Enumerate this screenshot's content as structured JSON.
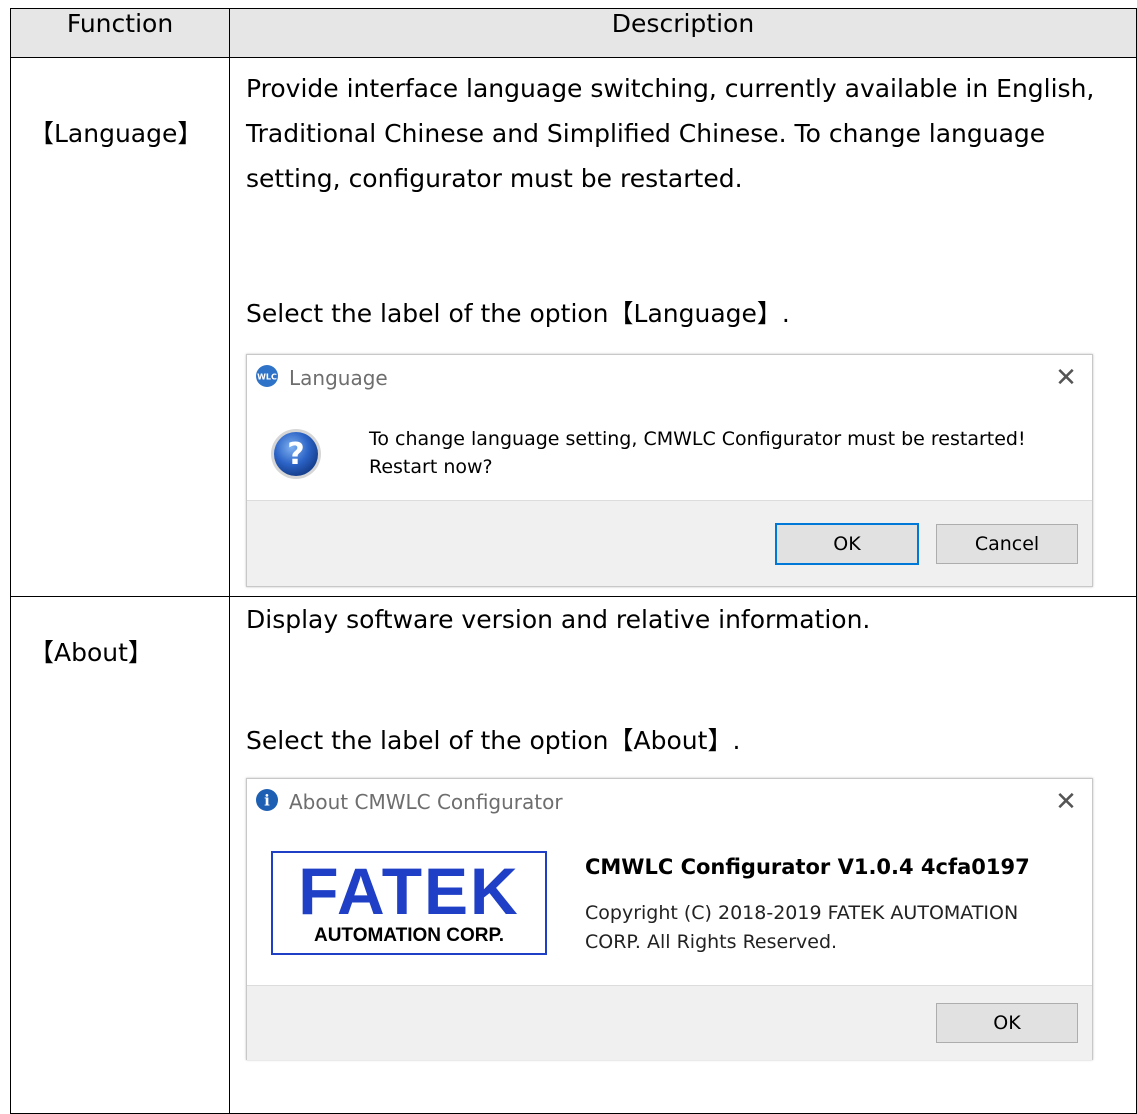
{
  "table": {
    "header_function": "Function",
    "header_description": "Description"
  },
  "rows": {
    "language": {
      "function": "【Language】",
      "description": "Provide interface language switching, currently available in English,\nTraditional Chinese and Simplified Chinese. To change language\nsetting, configurator must be restarted.",
      "instruction": "Select the label of the option【Language】."
    },
    "about": {
      "function": "【About】",
      "description": "Display software version and relative information.",
      "instruction": "Select the label of the option【About】."
    }
  },
  "language_dialog": {
    "title": "Language",
    "app_icon_text": "WLC",
    "message_line1": "To change language setting, CMWLC Configurator must be restarted!",
    "message_line2": "Restart now?",
    "ok_label": "OK",
    "cancel_label": "Cancel",
    "question_glyph": "?",
    "close_glyph": "✕"
  },
  "about_dialog": {
    "title": "About CMWLC Configurator",
    "info_glyph": "i",
    "logo_main": "FATEK",
    "logo_sub": "AUTOMATION CORP.",
    "product_name": "CMWLC Configurator V1.0.4 4cfa0197",
    "copyright_line1": "Copyright (C) 2018-2019 FATEK AUTOMATION",
    "copyright_line2": "CORP. All Rights Reserved.",
    "ok_label": "OK",
    "close_glyph": "✕"
  },
  "colors": {
    "header_bg": "#e6e6e6",
    "logo_blue": "#1f3fc7",
    "button_focus": "#0078d7",
    "dialog_footer": "#f0f0f0"
  }
}
